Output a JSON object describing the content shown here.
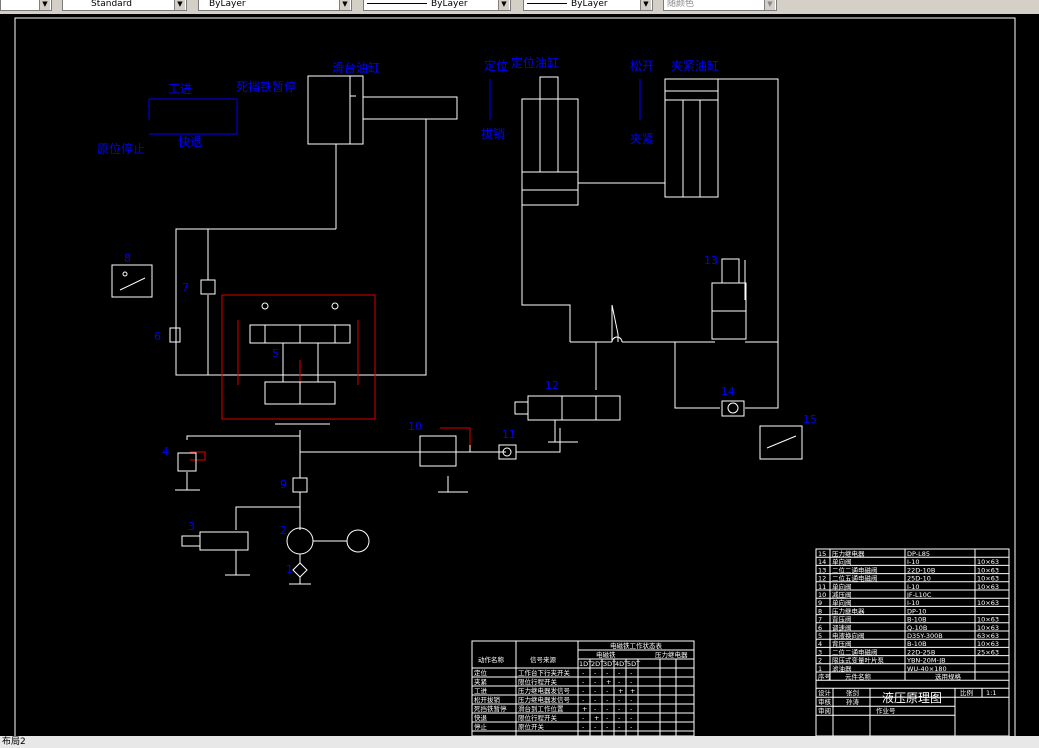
{
  "toolbar": {
    "textstyle": "Standard",
    "layer": "ByLayer",
    "linetype": "ByLayer",
    "lineweight": "ByLayer",
    "color": "随颜色"
  },
  "labels": {
    "cyl_table": "滑台油缸",
    "cyl_locate": "定位油缸",
    "cyl_clamp": "夹紧油缸",
    "locate": "定位",
    "pull_pin": "拔销",
    "loosen": "松开",
    "clamp": "夹紧",
    "work_feed": "工进",
    "dead_stop": "死挡铁暂停",
    "home_stop": "原位停止",
    "fast_return": "快退"
  },
  "numbers": [
    "1",
    "2",
    "3",
    "4",
    "5",
    "6",
    "7",
    "8",
    "9",
    "10",
    "11",
    "12",
    "13",
    "14",
    "15"
  ],
  "parts": {
    "rows": [
      [
        "15",
        "压力继电器",
        "DP-L85",
        ""
      ],
      [
        "14",
        "单向阀",
        "I-10",
        "10×63"
      ],
      [
        "13",
        "二位二通电磁阀",
        "22D-10B",
        "10×63"
      ],
      [
        "12",
        "二位五通电磁阀",
        "25D-10",
        "10×63"
      ],
      [
        "11",
        "单向阀",
        "I-10",
        "10×63"
      ],
      [
        "10",
        "减压阀",
        "JF-L10C",
        ""
      ],
      [
        "9",
        "单向阀",
        "I-10",
        "10×63"
      ],
      [
        "8",
        "压力继电器",
        "DP-10",
        ""
      ],
      [
        "7",
        "背压阀",
        "B-10B",
        "10×63"
      ],
      [
        "6",
        "调速阀",
        "Q-10B",
        "10×63"
      ],
      [
        "5",
        "电液换向阀",
        "D35Y-300B",
        "63×63"
      ],
      [
        "4",
        "背压阀",
        "B-10B",
        "10×63"
      ],
      [
        "3",
        "二位二通电磁阀",
        "22D-25B",
        "25×63"
      ],
      [
        "2",
        "限压式变量叶片泵",
        "YBN-20M-JB",
        ""
      ],
      [
        "1",
        "滤油器",
        "WU-40×180",
        ""
      ]
    ],
    "header": [
      "序号",
      "元件名称",
      "",
      "选用规格"
    ],
    "title": "液压原理图",
    "design": "设计",
    "designer": "张剑",
    "check": "审核",
    "checker": "孙涛",
    "audit": "审阅",
    "approve": "批准",
    "workno": "作业号",
    "scale": "比例",
    "sheet": "1:1"
  },
  "action_table": {
    "title": "电磁铁工作状态表",
    "col_action": "动作名称",
    "col_signal": "信号来源",
    "col_solenoid": "电磁铁",
    "col_pressure": "压力继电器",
    "solenoids": [
      "1DT",
      "2DT",
      "3DT",
      "4DT",
      "5DT"
    ],
    "rows": [
      [
        "定位",
        "工作台下行夹开关",
        "-",
        "-",
        "-",
        "-",
        "-"
      ],
      [
        "夹紧",
        "限位行程开关",
        "-",
        "-",
        "+",
        "-",
        "-"
      ],
      [
        "工进",
        "压力继电器发信号",
        "-",
        "-",
        "-",
        "+",
        "+"
      ],
      [
        "松开拔销",
        "压力继电器发信号",
        "-",
        "-",
        "-",
        "-",
        "-"
      ],
      [
        "死挡铁暂停",
        "滑台到工作位置",
        "+",
        "-",
        "-",
        "-",
        "-"
      ],
      [
        "快退",
        "限位行程开关",
        "-",
        "+",
        "-",
        "-",
        "-"
      ],
      [
        "停止",
        "原位开关",
        "-",
        "-",
        "-",
        "-",
        "-"
      ]
    ]
  },
  "status": {
    "tab": "布局2"
  }
}
